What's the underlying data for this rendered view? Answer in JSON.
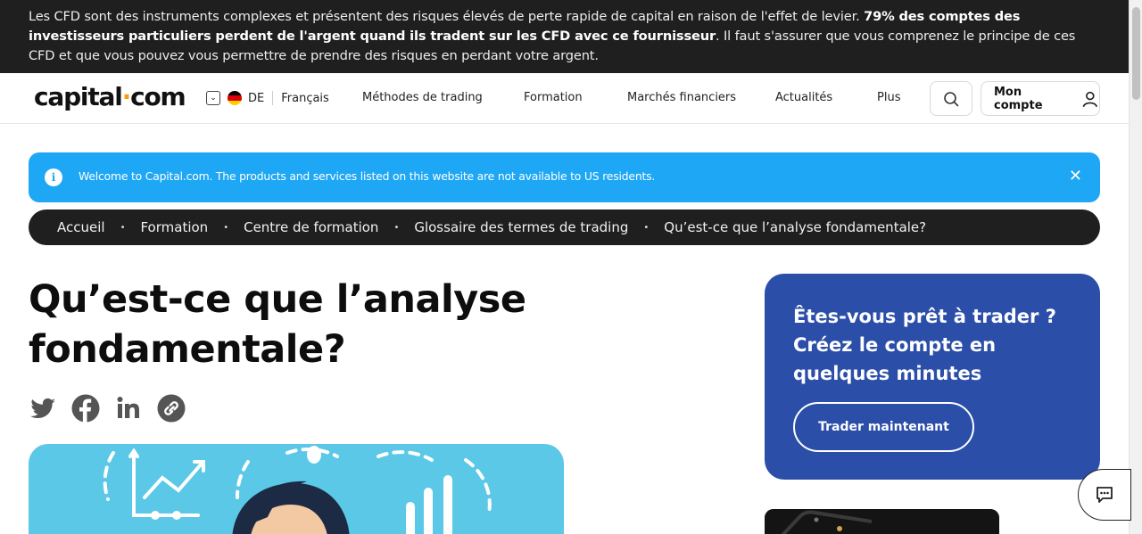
{
  "risk_banner": {
    "text_before": "Les CFD sont des instruments complexes et présentent des risques élevés de perte rapide de capital en raison de l'effet de levier. ",
    "text_bold": "79% des comptes des investisseurs particuliers perdent de l'argent quand ils tradent sur les CFD avec ce fournisseur",
    "text_after": ". Il faut s'assurer que vous comprenez le principe de ces CFD et que vous pouvez vous permettre de prendre des risques en perdant votre argent."
  },
  "header": {
    "logo_left": "capital",
    "logo_dot": "·",
    "logo_right": "com",
    "country_code": "DE",
    "language": "Français",
    "menu": [
      "Méthodes de trading",
      "Formation",
      "Marchés financiers",
      "Actualités",
      "Plus"
    ],
    "account_label": "Mon compte"
  },
  "notice": {
    "message": "Welcome to Capital.com. The products and services listed on this website are not available to US residents.",
    "info_glyph": "i",
    "close_glyph": "✕"
  },
  "breadcrumb": [
    "Accueil",
    "Formation",
    "Centre de formation",
    "Glossaire des termes de trading",
    "Qu’est-ce que l’analyse fondamentale?"
  ],
  "article": {
    "title": "Qu’est-ce que l’analyse fondamentale?"
  },
  "social_icons": [
    "twitter-icon",
    "facebook-icon",
    "linkedin-icon",
    "copy-link-icon"
  ],
  "cta": {
    "text": "Êtes-vous prêt à trader ? Créez le compte en quelques minutes",
    "button": "Trader maintenant"
  },
  "colors": {
    "banner_bg": "#1f1f1f",
    "notice_bg": "#1ea7f5",
    "cta_bg": "#2b4ea8",
    "logo_dot": "#f59e0b"
  }
}
